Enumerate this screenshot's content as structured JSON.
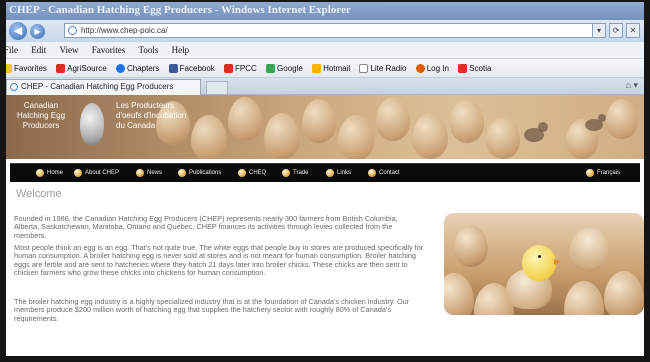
{
  "window": {
    "title": "CHEP - Canadian Hatching Egg Producers - Windows Internet Explorer"
  },
  "address": {
    "url": "http://www.chep-poic.ca/",
    "back_glyph": "◀",
    "forward_glyph": "▶",
    "tools": [
      "▾",
      "⟳",
      "✕"
    ]
  },
  "menu": {
    "items": [
      "File",
      "Edit",
      "View",
      "Favorites",
      "Tools",
      "Help"
    ]
  },
  "favorites": {
    "label": "Favorites",
    "items": [
      {
        "label": "AgriSource",
        "color": "#d93025"
      },
      {
        "label": "Chapters",
        "color": "#1a73e8"
      },
      {
        "label": "Facebook",
        "color": "#3b5998"
      },
      {
        "label": "FPCC",
        "color": "#d93025"
      },
      {
        "label": "Google",
        "color": "#34a853"
      },
      {
        "label": "Hotmail",
        "color": "#f4b400"
      },
      {
        "label": "Lite Radio",
        "color": "#7a7a7a"
      },
      {
        "label": "Log In",
        "color": "#e05a00"
      },
      {
        "label": "Scotia",
        "color": "#d93025"
      }
    ]
  },
  "tab": {
    "label": "CHEP - Canadian Hatching Egg Producers"
  },
  "banner": {
    "english": [
      "Canadian",
      "Hatching Egg",
      "Producers"
    ],
    "french": [
      "Les Producteurs",
      "d'oeufs d'incubation",
      "du Canada"
    ]
  },
  "nav": {
    "items": [
      "Home",
      "About CHEP",
      "News",
      "Publications",
      "CHEQ",
      "Trade",
      "Links",
      "Contact"
    ],
    "language": "Français"
  },
  "content": {
    "heading": "Welcome",
    "paragraphs": [
      "Founded in 1986, the Canadian Hatching Egg Producers (CHEP) represents nearly 300 farmers from British Columbia, Alberta, Saskatchewan, Manitoba, Ontario and Québec. CHEP finances its activities through levies collected from the members.",
      "Most people think an egg is an egg. That's not quite true. The white eggs that people buy in stores are produced specifically for human consumption. A broiler hatching egg is never sold at stores and is not meant for human consumption. Broiler hatching eggs are fertile and are sent to hatcheries where they hatch 21 days later into broiler chicks. These chicks are then sent to chicken farmers who grow these chicks into chickens for human consumption.",
      "The broiler hatching egg industry is a highly specialized industry that is at the foundation of Canada's chicken industry. Our members produce $200 million worth of hatching egg that supplies the hatchery sector with roughly 80% of Canada's requirements."
    ]
  },
  "colors": {
    "nav_background": "#0b0b0b",
    "text_gray": "#6a6a6a",
    "heading_gray": "#9c9c9c"
  }
}
